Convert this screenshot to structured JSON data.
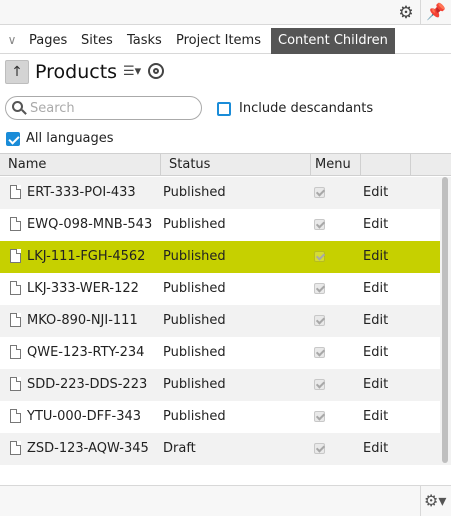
{
  "toolbar": {
    "settings_icon": "gear-icon",
    "pin_icon": "pin-icon",
    "accent": "#1a8cd8"
  },
  "tabs": [
    {
      "label": "Pages",
      "active": false
    },
    {
      "label": "Sites",
      "active": false
    },
    {
      "label": "Tasks",
      "active": false
    },
    {
      "label": "Project Items",
      "active": false
    },
    {
      "label": "Content Children",
      "active": true
    }
  ],
  "header": {
    "title": "Products"
  },
  "search": {
    "placeholder": "Search",
    "value": ""
  },
  "options": {
    "include_descendants": {
      "label": "Include descandants",
      "checked": false
    },
    "all_languages": {
      "label": "All languages",
      "checked": true
    }
  },
  "grid": {
    "columns": [
      "Name",
      "Status",
      "Menu",
      ""
    ],
    "edit_label": "Edit",
    "selected_color": "#c6d000",
    "rows": [
      {
        "name": "ERT-333-POI-433",
        "status": "Published",
        "menu": true,
        "selected": false
      },
      {
        "name": "EWQ-098-MNB-543",
        "status": "Published",
        "menu": true,
        "selected": false
      },
      {
        "name": "LKJ-111-FGH-4562",
        "status": "Published",
        "menu": true,
        "selected": true
      },
      {
        "name": "LKJ-333-WER-122",
        "status": "Published",
        "menu": true,
        "selected": false
      },
      {
        "name": "MKO-890-NJI-111",
        "status": "Published",
        "menu": true,
        "selected": false
      },
      {
        "name": "QWE-123-RTY-234",
        "status": "Published",
        "menu": true,
        "selected": false
      },
      {
        "name": "SDD-223-DDS-223",
        "status": "Published",
        "menu": true,
        "selected": false
      },
      {
        "name": "YTU-000-DFF-343",
        "status": "Published",
        "menu": true,
        "selected": false
      },
      {
        "name": "ZSD-123-AQW-345",
        "status": "Draft",
        "menu": true,
        "selected": false
      }
    ]
  }
}
